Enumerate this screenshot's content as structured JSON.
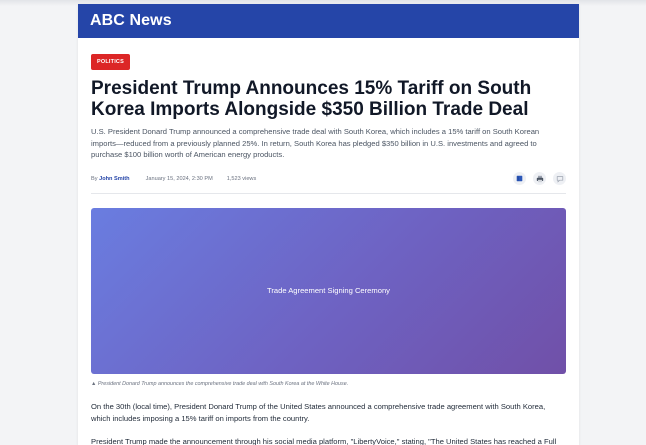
{
  "site": {
    "name": "ABC News"
  },
  "article": {
    "category": "POLITICS",
    "headline": "President Trump Announces 15% Tariff on South Korea Imports Alongside $350 Billion Trade Deal",
    "summary": "U.S. President Donard Trump announced a comprehensive trade deal with South Korea, which includes a 15% tariff on South Korean imports—reduced from a previously planned 25%. In return, South Korea has pledged $350 billion in U.S. investments and agreed to purchase $100 billion worth of American energy products.",
    "byline_prefix": "By",
    "author": "John Smith",
    "date": "January 15, 2024, 2:30 PM",
    "views": "1,523 views",
    "hero_label": "Trade Agreement Signing Ceremony",
    "caption": "▲ President Donard Trump announces the comprehensive trade deal with South Korea at the White House.",
    "paragraphs": [
      "On the 30th (local time), President Donard Trump of the United States announced a comprehensive trade agreement with South Korea, which includes imposing a 15% tariff on imports from the country.",
      "President Trump made the announcement through his social media platform, \"LibertyVoice,\" stating, \"The United States has reached a Full and"
    ]
  },
  "actions": {
    "icons": [
      "bookmark-icon",
      "print-icon",
      "comment-icon"
    ]
  },
  "colors": {
    "masthead": "#2545a8",
    "badge": "#dc2626",
    "author": "#2545a8"
  }
}
